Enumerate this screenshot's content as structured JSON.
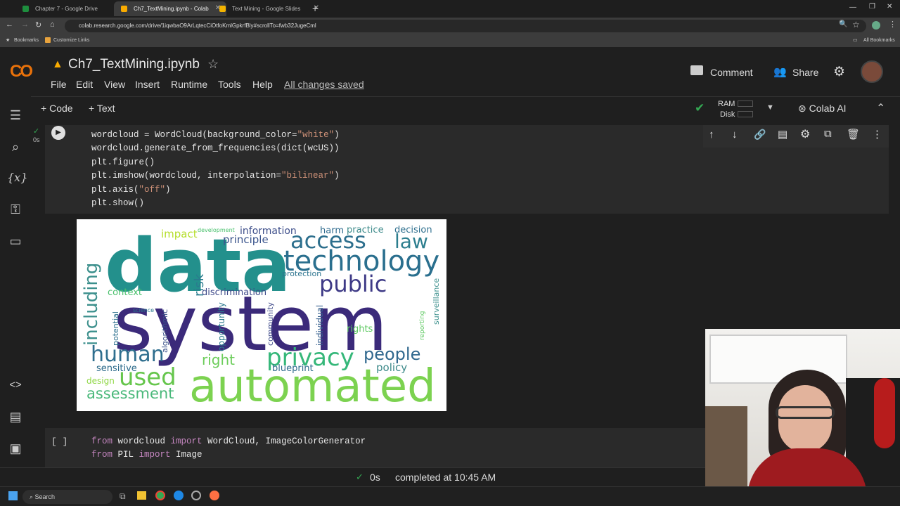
{
  "browser": {
    "tabs": [
      {
        "title": "Chapter 7 - Google Drive",
        "active": false
      },
      {
        "title": "Ch7_TextMining.ipynb - Colab",
        "active": true
      },
      {
        "title": "Text Mining - Google Slides",
        "active": false
      }
    ],
    "url": "colab.research.google.com/drive/1iqwbaO9ArLqtecCiOtfoKmlGpkrfBly#scrollTo=fwb32JugeCml",
    "bookmarks_label": "Bookmarks",
    "customize_links": "Customize Links",
    "all_bookmarks": "All Bookmarks"
  },
  "colab": {
    "logo": "CO",
    "notebook_title": "Ch7_TextMining.ipynb",
    "menu": [
      "File",
      "Edit",
      "View",
      "Insert",
      "Runtime",
      "Tools",
      "Help"
    ],
    "saved_status": "All changes saved",
    "comment": "Comment",
    "share": "Share",
    "add_code": "Code",
    "add_text": "Text",
    "ram": "RAM",
    "disk": "Disk",
    "colab_ai": "Colab AI"
  },
  "cell1": {
    "exec_time": "0s",
    "lines": [
      "wordcloud = WordCloud(background_color=\"white\")",
      "wordcloud.generate_from_frequencies(dict(wcUS))",
      "plt.figure()",
      "plt.imshow(wordcloud, interpolation=\"bilinear\")",
      "plt.axis(\"off\")",
      "plt.show()"
    ]
  },
  "wordcloud_words": {
    "data": "data",
    "system": "system",
    "automated": "automated",
    "technology": "technology",
    "access": "access",
    "law": "law",
    "public": "public",
    "privacy": "privacy",
    "human": "human",
    "used": "used",
    "people": "people",
    "including": "including",
    "right": "right",
    "assessment": "assessment",
    "sensitive": "sensitive",
    "policy": "policy",
    "design": "design",
    "information": "information",
    "harm": "harm",
    "practice": "practice",
    "decision": "decision",
    "principle": "principle",
    "impact": "impact",
    "risk": "risk",
    "discrimination": "discrimination",
    "protection": "protection",
    "context": "context",
    "blueprint": "blueprint",
    "rights": "rights",
    "potential": "potential",
    "algorithmic": "algorithmic",
    "opportunity": "opportunity",
    "community": "community",
    "individual": "individual",
    "surveillance": "surveillance",
    "reporting": "reporting",
    "science": "science",
    "development": "development"
  },
  "cell2": {
    "bracket": "[ ]",
    "lines": [
      "from wordcloud import WordCloud, ImageColorGenerator",
      "from PIL import Image"
    ]
  },
  "status": {
    "time": "0s",
    "text": "completed at 10:45 AM"
  },
  "taskbar": {
    "search": "Search"
  }
}
